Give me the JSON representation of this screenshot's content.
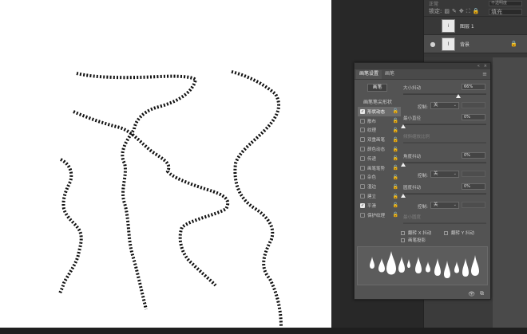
{
  "layers": {
    "blend_mode": "正常",
    "opacity_label": "不透明度",
    "lock_label": "锁定:",
    "fill_label": "填充",
    "lock_icons": [
      "▨",
      "✎",
      "✥",
      "⛶",
      "🔒"
    ],
    "items": [
      {
        "name": "图层 1",
        "thumb": "⁞",
        "selected": false,
        "visible": false,
        "locked": false
      },
      {
        "name": "背景",
        "thumb": "⌇",
        "selected": true,
        "visible": true,
        "locked": true
      }
    ]
  },
  "brush_panel": {
    "tabs": [
      "画笔设置",
      "画笔"
    ],
    "title_icons": [
      "«",
      "×"
    ],
    "menu_icon": "≡",
    "preset_button": "画笔",
    "list_header": "画笔笔尖形状",
    "items": [
      {
        "label": "形状动态",
        "checked": true,
        "active": true
      },
      {
        "label": "散布",
        "checked": false,
        "active": false
      },
      {
        "label": "纹理",
        "checked": false,
        "active": false
      },
      {
        "label": "双重画笔",
        "checked": false,
        "active": false
      },
      {
        "label": "颜色动态",
        "checked": false,
        "active": false
      },
      {
        "label": "传递",
        "checked": false,
        "active": false
      },
      {
        "label": "画笔笔势",
        "checked": false,
        "active": false
      },
      {
        "label": "杂色",
        "checked": false,
        "active": false
      },
      {
        "label": "湿边",
        "checked": false,
        "active": false
      },
      {
        "label": "建立",
        "checked": false,
        "active": false
      },
      {
        "label": "平滑",
        "checked": true,
        "active": false
      },
      {
        "label": "保护纹理",
        "checked": false,
        "active": false
      }
    ],
    "lock_icon": "🔓",
    "size_jitter": {
      "label": "大小抖动",
      "value": "66%",
      "level": 0.66
    },
    "control_label": "控制:",
    "control_1": "关",
    "min_diameter": {
      "label": "最小直径",
      "value": "0%",
      "level": 0
    },
    "tilt_scale": {
      "label": "倾斜缩放比例"
    },
    "angle_jitter": {
      "label": "角度抖动",
      "value": "0%",
      "level": 0
    },
    "control_2": "关",
    "roundness_jitter": {
      "label": "圆度抖动",
      "value": "0%",
      "level": 0
    },
    "control_3": "关",
    "min_roundness": {
      "label": "最小圆度"
    },
    "flip_x": "翻转 X 抖动",
    "flip_y": "翻转 Y 抖动",
    "projection": "画笔投影",
    "footer_icons": [
      "👁",
      "⧉"
    ]
  }
}
